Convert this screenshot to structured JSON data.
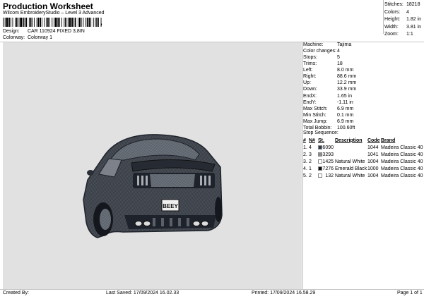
{
  "header": {
    "title": "Production Worksheet",
    "subtitle": "Wilcom EmbroideryStudio – Level 3 Advanced",
    "barcode_suffix": ",",
    "design_label": "Design:",
    "design_value": "CAR 110924 FIXED 3,8IN",
    "colorway_label": "Colorway:",
    "colorway_value": "Colorway 1"
  },
  "stats": [
    {
      "label": "Stitches:",
      "value": "18218"
    },
    {
      "label": "Colors:",
      "value": "4"
    },
    {
      "label": "Height:",
      "value": "1.82 in"
    },
    {
      "label": "Width:",
      "value": "3.81 in"
    },
    {
      "label": "Zoom:",
      "value": "1:1"
    }
  ],
  "info": [
    {
      "label": "Machine:",
      "value": "Tajima"
    },
    {
      "label": "Color changes:",
      "value": "4"
    },
    {
      "label": "Stops:",
      "value": "5"
    },
    {
      "label": "Trims:",
      "value": "18"
    },
    {
      "label": "Left:",
      "value": "8.0 mm"
    },
    {
      "label": "Right:",
      "value": "88.6 mm"
    },
    {
      "label": "Up:",
      "value": "12.2 mm"
    },
    {
      "label": "Down:",
      "value": "33.9 mm"
    },
    {
      "label": "EndX:",
      "value": "1.65 in"
    },
    {
      "label": "EndY:",
      "value": "-1.11 in"
    },
    {
      "label": "Max Stitch:",
      "value": "6.9 mm"
    },
    {
      "label": "Min Stitch:",
      "value": "0.1 mm"
    },
    {
      "label": "Max Jump:",
      "value": "6.9 mm"
    },
    {
      "label": "Total Bobbin:",
      "value": "100.60ft"
    }
  ],
  "stop_sequence": {
    "title": "Stop Sequence:",
    "headers": {
      "num": "#",
      "n": "N#",
      "st": "St.",
      "desc": "Description",
      "code": "Code",
      "brand": "Brand"
    },
    "rows": [
      {
        "num": "1.",
        "n": "4",
        "color": "#2e3a50",
        "st": "6090",
        "desc": "",
        "code": "1044",
        "brand": "Madeira Classic 40"
      },
      {
        "num": "2.",
        "n": "3",
        "color": "#8a8a92",
        "st": "3293",
        "desc": "",
        "code": "1041",
        "brand": "Madeira Classic 40"
      },
      {
        "num": "3.",
        "n": "2",
        "color": "#ffffff",
        "st": "1425",
        "desc": "Natural White",
        "code": "1004",
        "brand": "Madeira Classic 40"
      },
      {
        "num": "4.",
        "n": "1",
        "color": "#111111",
        "st": "7276",
        "desc": "Emerald Black",
        "code": "1000",
        "brand": "Madeira Classic 40"
      },
      {
        "num": "5.",
        "n": "2",
        "color": "#ffffff",
        "st": "132",
        "desc": "Natural White",
        "code": "1004",
        "brand": "Madeira Classic 40"
      }
    ]
  },
  "design": {
    "plate_text": "BEEY",
    "colors": {
      "background": "#e1e1e1",
      "car_dark": "#1e232b",
      "car_mid": "#5a606a",
      "car_light": "#a9adb3"
    }
  },
  "footer": {
    "created_by": "Created By:",
    "last_saved": "Last Saved: 17/09/2024 16.02.33",
    "printed": "Printed: 17/09/2024 16.58.29",
    "page": "Page 1 of 1"
  }
}
